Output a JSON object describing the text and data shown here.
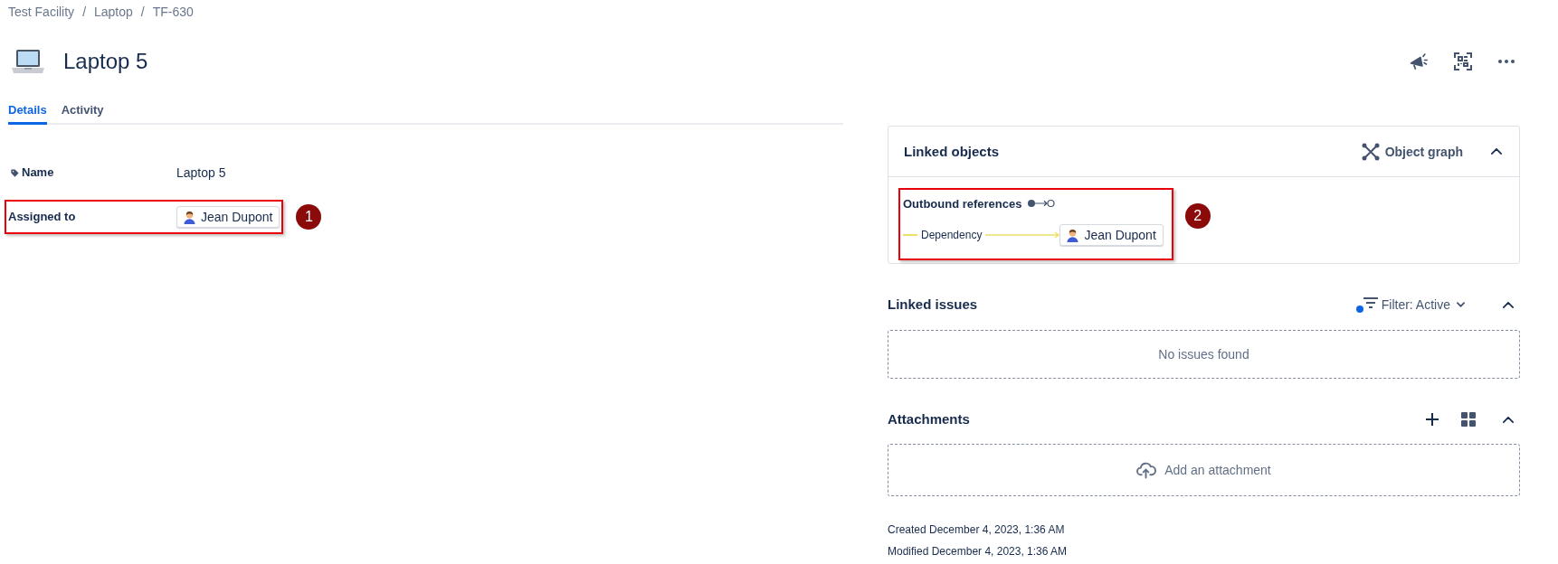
{
  "breadcrumb": {
    "items": [
      "Test Facility",
      "Laptop",
      "TF-630"
    ],
    "separators": [
      "/",
      "/"
    ]
  },
  "title": "Laptop 5",
  "tabs": [
    {
      "label": "Details",
      "selected": true
    },
    {
      "label": "Activity",
      "selected": false
    }
  ],
  "fields": [
    {
      "label": "Name",
      "kind": "label",
      "value": "Laptop 5"
    },
    {
      "label": "Assigned to",
      "kind": "user",
      "value": "Jean Dupont",
      "annotation": "1"
    }
  ],
  "linked_objects": {
    "title": "Linked objects",
    "graph_button": "Object graph",
    "expanded": true,
    "outbound": {
      "title": "Outbound references",
      "annotation": "2",
      "references": [
        {
          "relation": "Dependency",
          "target": "Jean Dupont"
        }
      ]
    }
  },
  "linked_issues": {
    "title": "Linked issues",
    "filter": "Filter: Active",
    "filter_active": true,
    "expanded": true,
    "empty_text": "No issues found"
  },
  "attachments": {
    "title": "Attachments",
    "expanded": true,
    "upload_text": "Add an attachment"
  },
  "footer": {
    "created": "Created December 4, 2023, 1:36 AM",
    "modified": "Modified December 4, 2023, 1:36 AM"
  }
}
